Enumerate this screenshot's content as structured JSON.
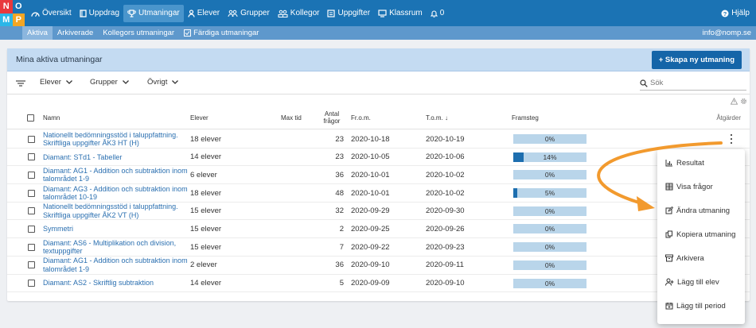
{
  "brand": {
    "letters": [
      "N",
      "O",
      "M",
      "P"
    ],
    "colors": [
      "#e8383d",
      "#1b73b4",
      "#2bb6e8",
      "#f3a623"
    ]
  },
  "nav": {
    "items": [
      {
        "label": "Översikt",
        "icon": "dashboard-icon"
      },
      {
        "label": "Uppdrag",
        "icon": "book-icon"
      },
      {
        "label": "Utmaningar",
        "icon": "trophy-icon"
      },
      {
        "label": "Elever",
        "icon": "user-icon"
      },
      {
        "label": "Grupper",
        "icon": "group-icon"
      },
      {
        "label": "Kollegor",
        "icon": "colleagues-icon"
      },
      {
        "label": "Uppgifter",
        "icon": "tasks-icon"
      },
      {
        "label": "Klassrum",
        "icon": "classroom-icon"
      },
      {
        "label": "0",
        "icon": "bell-icon"
      }
    ],
    "help": "Hjälp"
  },
  "subnav": {
    "items": [
      "Aktiva",
      "Arkiverade",
      "Kollegors utmaningar",
      "Färdiga utmaningar"
    ],
    "email": "info@nomp.se"
  },
  "card": {
    "title": "Mina aktiva utmaningar",
    "create_button": "+ Skapa ny utmaning"
  },
  "filters": {
    "elever": "Elever",
    "grupper": "Grupper",
    "ovrigt": "Övrigt",
    "search_placeholder": "Sök"
  },
  "table": {
    "headers": {
      "namn": "Namn",
      "elever": "Elever",
      "max_tid": "Max tid",
      "antal_line1": "Antal",
      "antal_line2": "frågor",
      "from": "Fr.o.m.",
      "tom": "T.o.m. ↓",
      "framsteg": "Framsteg",
      "atgarder": "Åtgärder"
    },
    "rows": [
      {
        "name": "Nationellt bedömningsstöd i taluppfattning. Skriftliga uppgifter ÅK3 HT (H)",
        "elever": "18 elever",
        "antal": "23",
        "from": "2020-10-18",
        "tom": "2020-10-19",
        "progress_label": "0%",
        "progress": 0
      },
      {
        "name": "Diamant: STd1 - Tabeller",
        "elever": "14 elever",
        "antal": "23",
        "from": "2020-10-05",
        "tom": "2020-10-06",
        "progress_label": "14%",
        "progress": 14
      },
      {
        "name": "Diamant: AG1 - Addition och subtraktion inom talområdet 1-9",
        "elever": "6 elever",
        "antal": "36",
        "from": "2020-10-01",
        "tom": "2020-10-02",
        "progress_label": "0%",
        "progress": 0
      },
      {
        "name": "Diamant: AG3 - Addition och subtraktion inom talområdet 10-19",
        "elever": "18 elever",
        "antal": "48",
        "from": "2020-10-01",
        "tom": "2020-10-02",
        "progress_label": "5%",
        "progress": 5
      },
      {
        "name": "Nationellt bedömningsstöd i taluppfattning. Skriftliga uppgifter ÅK2 VT (H)",
        "elever": "15 elever",
        "antal": "32",
        "from": "2020-09-29",
        "tom": "2020-09-30",
        "progress_label": "0%",
        "progress": 0
      },
      {
        "name": "Symmetri",
        "elever": "15 elever",
        "antal": "2",
        "from": "2020-09-25",
        "tom": "2020-09-26",
        "progress_label": "0%",
        "progress": 0
      },
      {
        "name": "Diamant: AS6 - Multiplikation och division, textuppgifter",
        "elever": "15 elever",
        "antal": "7",
        "from": "2020-09-22",
        "tom": "2020-09-23",
        "progress_label": "0%",
        "progress": 0
      },
      {
        "name": "Diamant: AG1 - Addition och subtraktion inom talområdet 1-9",
        "elever": "2 elever",
        "antal": "36",
        "from": "2020-09-10",
        "tom": "2020-09-11",
        "progress_label": "0%",
        "progress": 0
      },
      {
        "name": "Diamant: AS2 - Skriftlig subtraktion",
        "elever": "14 elever",
        "antal": "5",
        "from": "2020-09-09",
        "tom": "2020-09-10",
        "progress_label": "0%",
        "progress": 0
      }
    ]
  },
  "menu": {
    "items": [
      {
        "label": "Resultat",
        "icon": "chart-icon"
      },
      {
        "label": "Visa frågor",
        "icon": "grid-icon"
      },
      {
        "label": "Ändra utmaning",
        "icon": "edit-icon"
      },
      {
        "label": "Kopiera utmaning",
        "icon": "copy-icon"
      },
      {
        "label": "Arkivera",
        "icon": "archive-icon"
      },
      {
        "label": "Lägg till elev",
        "icon": "add-user-icon"
      },
      {
        "label": "Lägg till period",
        "icon": "calendar-icon"
      }
    ]
  },
  "colors": {
    "primary": "#1b73b4",
    "subbar": "#5e98cc",
    "card_header": "#c4dbf2",
    "button": "#1565a8",
    "link": "#2a6fb0",
    "progress_bg": "#b9d5ea",
    "progress_fill": "#1d6eaf",
    "arrow": "#f29a2e"
  }
}
